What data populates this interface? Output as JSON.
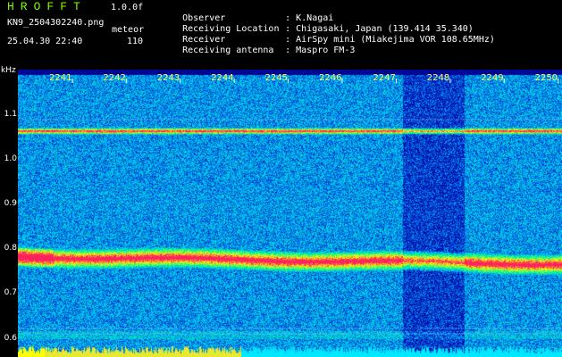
{
  "header": {
    "logo": "HROFFT",
    "version": "1.0.0f",
    "filename": "KN9_2504302240.png",
    "mode": "meteor",
    "datetime": "25.04.30 22:40",
    "count": "110"
  },
  "meta": [
    {
      "key": "Observer",
      "value": ": K.Nagai"
    },
    {
      "key": "Receiving Location",
      "value": ": Chigasaki, Japan (139.414 35.340)"
    },
    {
      "key": "Receiver",
      "value": ": AirSpy mini (Miakejima VOR 108.65MHz)"
    },
    {
      "key": "Receiving antenna",
      "value": ": Maspro FM-3"
    }
  ],
  "colors": {
    "background": "#000000",
    "logo": "#7CFC00",
    "tick_labels": "#ffff66",
    "axis_text": "#ffffff"
  },
  "chart_data": {
    "type": "heatmap",
    "ylabel": "kHz",
    "xlabel": "",
    "x_ticks": [
      "2241",
      "2242",
      "2243",
      "2244",
      "2245",
      "2246",
      "2247",
      "2248",
      "2249",
      "2250"
    ],
    "y_ticks": [
      "1.1",
      "1.0",
      "0.9",
      "0.8",
      "0.7",
      "0.6"
    ],
    "xlim": [
      "2240",
      "2250"
    ],
    "ylim": [
      0.6,
      1.12
    ],
    "features": [
      {
        "name": "carrier",
        "freq_khz": 1.065
      },
      {
        "name": "signal band",
        "freq_khz": [
          0.77,
          0.79
        ]
      }
    ],
    "colormap": [
      "#000060",
      "#0010c0",
      "#00c0ff",
      "#00ff80",
      "#ffff00",
      "#ff2060"
    ]
  }
}
